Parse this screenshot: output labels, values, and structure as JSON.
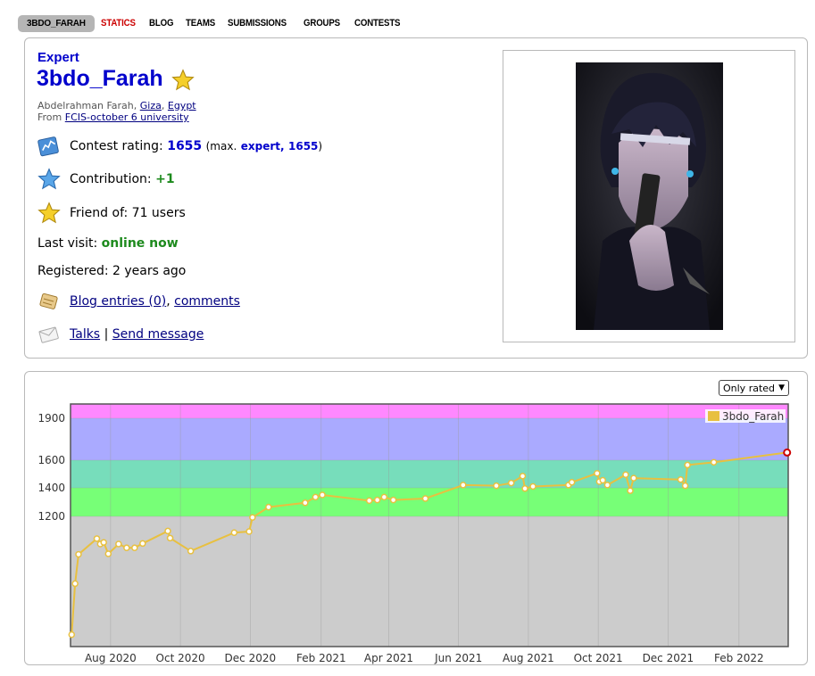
{
  "tabs": [
    "3BDO_FARAH",
    "STATICS",
    "BLOG",
    "TEAMS",
    "SUBMISSIONS",
    "GROUPS",
    "CONTESTS"
  ],
  "profile": {
    "rank": "Expert",
    "handle": "3bdo_Farah",
    "name": "Abdelrahman Farah,",
    "city": "Giza",
    "country": "Egypt",
    "from_label": "From",
    "org": "FCIS-october 6 university",
    "rating_label": "Contest rating:",
    "rating": "1655",
    "max_prefix": "(max.",
    "max_rank": "expert,",
    "max_rating": "1655",
    "max_suffix": ")",
    "contribution_label": "Contribution:",
    "contribution": "+1",
    "friend_label": "Friend of: 71 users",
    "last_visit_label": "Last visit:",
    "last_visit": "online now",
    "registered": "Registered: 2 years ago",
    "blog_entries": "Blog entries (0)",
    "comments": "comments",
    "talks": "Talks",
    "separator": "|",
    "send_message": "Send message",
    "colors": {
      "expert": "#0000cc",
      "online": "#1d8a1d",
      "statics": "#cc0000"
    }
  },
  "chart_control": {
    "filter": "Only rated"
  },
  "chart_data": {
    "type": "line",
    "series": [
      {
        "name": "3bdo_Farah",
        "color": "#e8c040",
        "points": [
          [
            "2020-06-28",
            110
          ],
          [
            "2020-07-01",
            580
          ],
          [
            "2020-07-04",
            850
          ],
          [
            "2020-07-20",
            995
          ],
          [
            "2020-07-23",
            945
          ],
          [
            "2020-07-26",
            960
          ],
          [
            "2020-07-30",
            855
          ],
          [
            "2020-08-08",
            945
          ],
          [
            "2020-08-15",
            910
          ],
          [
            "2020-08-22",
            910
          ],
          [
            "2020-08-29",
            950
          ],
          [
            "2020-09-20",
            1065
          ],
          [
            "2020-09-22",
            1000
          ],
          [
            "2020-10-10",
            880
          ],
          [
            "2020-11-17",
            1050
          ],
          [
            "2020-11-30",
            1060
          ],
          [
            "2020-12-03",
            1190
          ],
          [
            "2020-12-17",
            1265
          ],
          [
            "2021-01-18",
            1295
          ],
          [
            "2021-01-27",
            1335
          ],
          [
            "2021-02-02",
            1350
          ],
          [
            "2021-03-15",
            1310
          ],
          [
            "2021-03-22",
            1315
          ],
          [
            "2021-03-28",
            1335
          ],
          [
            "2021-04-05",
            1315
          ],
          [
            "2021-05-03",
            1325
          ],
          [
            "2021-06-05",
            1420
          ],
          [
            "2021-07-04",
            1415
          ],
          [
            "2021-07-17",
            1435
          ],
          [
            "2021-07-27",
            1485
          ],
          [
            "2021-07-29",
            1395
          ],
          [
            "2021-08-05",
            1410
          ],
          [
            "2021-09-05",
            1420
          ],
          [
            "2021-09-08",
            1440
          ],
          [
            "2021-09-30",
            1505
          ],
          [
            "2021-10-02",
            1445
          ],
          [
            "2021-10-05",
            1455
          ],
          [
            "2021-10-09",
            1420
          ],
          [
            "2021-10-25",
            1495
          ],
          [
            "2021-10-29",
            1380
          ],
          [
            "2021-11-01",
            1470
          ],
          [
            "2021-12-12",
            1460
          ],
          [
            "2021-12-16",
            1415
          ],
          [
            "2021-12-18",
            1565
          ],
          [
            "2022-01-10",
            1585
          ],
          [
            "2022-03-15",
            1655
          ]
        ]
      }
    ],
    "x_ticks": [
      "Aug 2020",
      "Oct 2020",
      "Dec 2020",
      "Feb 2021",
      "Apr 2021",
      "Jun 2021",
      "Aug 2021",
      "Oct 2021",
      "Dec 2021",
      "Feb 2022"
    ],
    "y_ticks": [
      "1200",
      "1400",
      "1600",
      "1900"
    ],
    "bands": [
      {
        "from": 0,
        "to": 1200,
        "color": "#cccccc"
      },
      {
        "from": 1200,
        "to": 1400,
        "color": "#77ff77"
      },
      {
        "from": 1400,
        "to": 1600,
        "color": "#77ddbb"
      },
      {
        "from": 1600,
        "to": 1900,
        "color": "#aaaaff"
      },
      {
        "from": 1900,
        "to": 2100,
        "color": "#ff88ff"
      }
    ],
    "legend": "top-right"
  }
}
